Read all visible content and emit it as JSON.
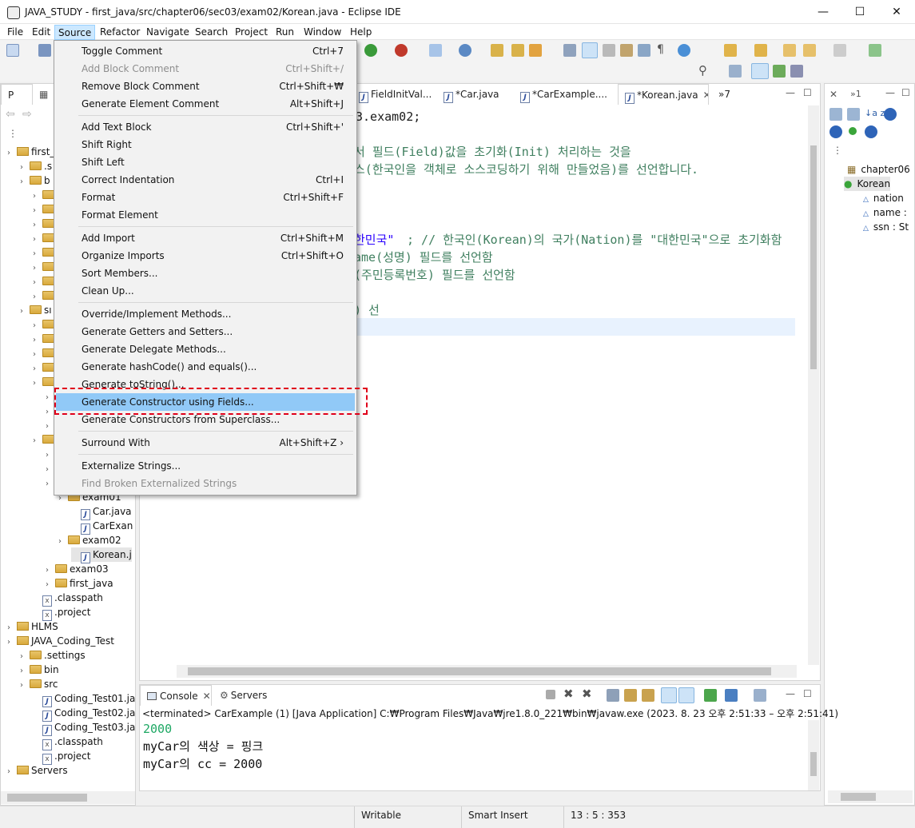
{
  "window": {
    "title": "JAVA_STUDY - first_java/src/chapter06/sec03/exam02/Korean.java - Eclipse IDE",
    "minimize": "—",
    "maximize": "☐",
    "close": "✕"
  },
  "menubar": [
    "File",
    "Edit",
    "Source",
    "Refactor",
    "Navigate",
    "Search",
    "Project",
    "Run",
    "Window",
    "Help"
  ],
  "package_explorer": {
    "tabs": [
      "P",
      "»"
    ],
    "rows": [
      {
        "text": "first_",
        "level": 0,
        "icon": "project"
      },
      {
        "text": ".s",
        "level": 1,
        "icon": "folder"
      },
      {
        "text": "b",
        "level": 1,
        "icon": "folder"
      },
      {
        "text": "",
        "level": 2,
        "icon": "folder"
      },
      {
        "text": "",
        "level": 2,
        "icon": "folder"
      },
      {
        "text": "",
        "level": 2,
        "icon": "folder"
      },
      {
        "text": "",
        "level": 2,
        "icon": "folder"
      },
      {
        "text": "",
        "level": 2,
        "icon": "folder"
      },
      {
        "text": "",
        "level": 2,
        "icon": "folder"
      },
      {
        "text": "",
        "level": 2,
        "icon": "folder"
      },
      {
        "text": "",
        "level": 2,
        "icon": "folder"
      },
      {
        "text": "sı",
        "level": 1,
        "icon": "folder"
      },
      {
        "text": "",
        "level": 2,
        "icon": "folder"
      },
      {
        "text": "",
        "level": 2,
        "icon": "folder"
      },
      {
        "text": "",
        "level": 2,
        "icon": "folder"
      },
      {
        "text": "",
        "level": 2,
        "icon": "folder"
      },
      {
        "text": "",
        "level": 2,
        "icon": "folder"
      },
      {
        "text": "",
        "level": 3,
        "icon": "folder"
      },
      {
        "text": "",
        "level": 3,
        "icon": "folder"
      },
      {
        "text": "",
        "level": 3,
        "icon": "folder"
      },
      {
        "text": "",
        "level": 2,
        "icon": "folder"
      },
      {
        "text": "",
        "level": 3,
        "icon": "folder"
      },
      {
        "text": "",
        "level": 3,
        "icon": "folder"
      },
      {
        "text": "",
        "level": 3,
        "icon": "folder"
      },
      {
        "text": "exam01",
        "level": 4,
        "icon": "folder"
      },
      {
        "text": "Car.java",
        "level": 5,
        "icon": "java"
      },
      {
        "text": "CarExan",
        "level": 5,
        "icon": "java"
      },
      {
        "text": "exam02",
        "level": 4,
        "icon": "folder"
      },
      {
        "text": "Korean.j",
        "level": 5,
        "icon": "java",
        "selected": true
      },
      {
        "text": "exam03",
        "level": 3,
        "icon": "folder"
      },
      {
        "text": "first_java",
        "level": 3,
        "icon": "folder"
      },
      {
        "text": ".classpath",
        "level": 2,
        "icon": "x"
      },
      {
        "text": ".project",
        "level": 2,
        "icon": "x"
      },
      {
        "text": "HLMS",
        "level": 0,
        "icon": "project"
      },
      {
        "text": "JAVA_Coding_Test",
        "level": 0,
        "icon": "project"
      },
      {
        "text": ".settings",
        "level": 1,
        "icon": "folder"
      },
      {
        "text": "bin",
        "level": 1,
        "icon": "folder"
      },
      {
        "text": "src",
        "level": 1,
        "icon": "folder"
      },
      {
        "text": "Coding_Test01.ja",
        "level": 2,
        "icon": "java"
      },
      {
        "text": "Coding_Test02.ja",
        "level": 2,
        "icon": "java"
      },
      {
        "text": "Coding_Test03.ja",
        "level": 2,
        "icon": "java"
      },
      {
        "text": ".classpath",
        "level": 2,
        "icon": "x"
      },
      {
        "text": ".project",
        "level": 2,
        "icon": "x"
      },
      {
        "text": "Servers",
        "level": 0,
        "icon": "project"
      }
    ]
  },
  "editor": {
    "tabs": [
      "FieldInitVal...",
      "*Car.java",
      "*CarExample....",
      "*Korean.java",
      "»7"
    ],
    "active_tab": "*Korean.java",
    "lines": {
      "l1": "3.exam02;",
      "l2a": "서 필드(Field)값을 초기화(Init) 처리하는 것을",
      "l2b": "스(한국인을 객체로 소스코딩하기 위해 만들었음)를 선언합니다.",
      "l3_str": "한민국\"",
      "l3_rest": "; // 한국인(Korean)의 국가(Nation)를 \"대한민국\"으로 초기화함",
      "l4": "ame(성명) 필드를 선언함",
      "l5": "(주민등록번호) 필드를 선언함",
      "l6": ") 선"
    }
  },
  "source_menu": {
    "items": [
      {
        "label": "Toggle Comment",
        "accel": "Ctrl+7"
      },
      {
        "label": "Add Block Comment",
        "accel": "Ctrl+Shift+/",
        "disabled": true
      },
      {
        "label": "Remove Block Comment",
        "accel": "Ctrl+Shift+₩"
      },
      {
        "label": "Generate Element Comment",
        "accel": "Alt+Shift+J"
      },
      {
        "label": "Add Text Block",
        "accel": "Ctrl+Shift+'"
      },
      {
        "label": "Shift Right",
        "accel": ""
      },
      {
        "label": "Shift Left",
        "accel": ""
      },
      {
        "label": "Correct Indentation",
        "accel": "Ctrl+I"
      },
      {
        "label": "Format",
        "accel": "Ctrl+Shift+F"
      },
      {
        "label": "Format Element",
        "accel": ""
      },
      {
        "label": "Add Import",
        "accel": "Ctrl+Shift+M"
      },
      {
        "label": "Organize Imports",
        "accel": "Ctrl+Shift+O"
      },
      {
        "label": "Sort Members...",
        "accel": ""
      },
      {
        "label": "Clean Up...",
        "accel": ""
      },
      {
        "label": "Override/Implement Methods...",
        "accel": ""
      },
      {
        "label": "Generate Getters and Setters...",
        "accel": ""
      },
      {
        "label": "Generate Delegate Methods...",
        "accel": ""
      },
      {
        "label": "Generate hashCode() and equals()...",
        "accel": ""
      },
      {
        "label": "Generate toString()...",
        "accel": ""
      },
      {
        "label": "Generate Constructor using Fields...",
        "accel": "",
        "highlighted": true
      },
      {
        "label": "Generate Constructors from Superclass...",
        "accel": ""
      },
      {
        "label": "Surround With",
        "accel": "Alt+Shift+Z ›"
      },
      {
        "label": "Externalize Strings...",
        "accel": ""
      },
      {
        "label": "Find Broken Externalized Strings",
        "accel": "",
        "disabled": true
      }
    ]
  },
  "outline": {
    "rows": [
      {
        "text": "chapter06",
        "icon": "package"
      },
      {
        "text": "Korean",
        "icon": "class",
        "selected": true
      },
      {
        "text": "nation",
        "icon": "field"
      },
      {
        "text": "name : ",
        "icon": "field"
      },
      {
        "text": "ssn : St",
        "icon": "field"
      }
    ]
  },
  "console": {
    "tabs": [
      "Console",
      "Servers"
    ],
    "header": "<terminated> CarExample (1) [Java Application] C:₩Program Files₩Java₩jre1.8.0_221₩bin₩javaw.exe  (2023. 8. 23 오후 2:51:33 – 오후 2:51:41)",
    "lines": [
      "2000",
      "myCar의 색상 = 핑크",
      "myCar의 cc = 2000"
    ]
  },
  "statusbar": {
    "writable": "Writable",
    "insert": "Smart Insert",
    "position": "13 : 5 : 353"
  },
  "colors": {
    "menu_highlight": "#91c9f7",
    "callout": "#e0001a",
    "comment": "#3f7f5f",
    "string": "#2a00ff",
    "console_first": "#1ea864"
  }
}
